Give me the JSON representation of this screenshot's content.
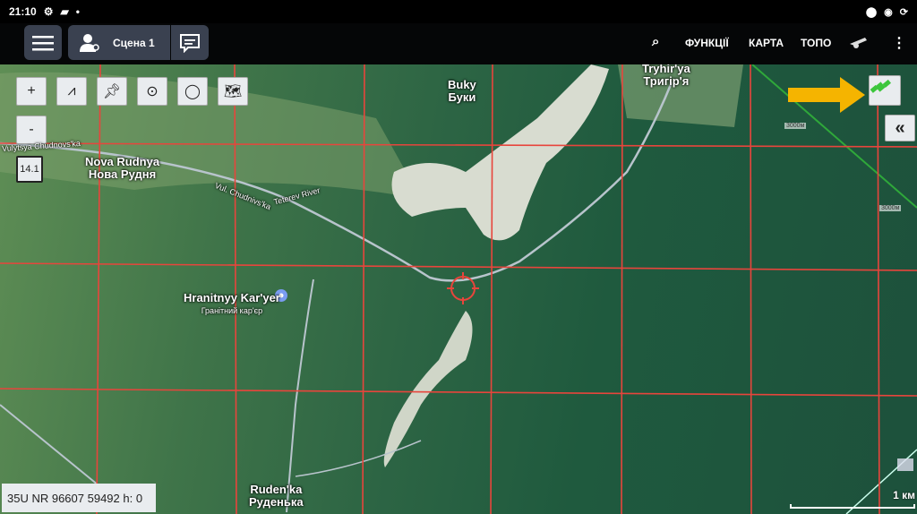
{
  "status": {
    "time": "21:10",
    "icons": [
      "gear-icon",
      "image-icon",
      "dot-icon"
    ],
    "right_icons": [
      "location-icon",
      "eye-icon",
      "sync-icon"
    ]
  },
  "topbar": {
    "scene_label": "Сцена 1",
    "actions": {
      "functions": "ФУНКЦІЇ",
      "map": "КАРТА",
      "topo": "ТОПО"
    }
  },
  "tools": {
    "zoom_in": "+",
    "zoom_out": "-",
    "zoom_level": "14.1",
    "collapse": "«"
  },
  "places": [
    {
      "lat": "Nova Rudnya",
      "cyr": "Нова Рудня"
    },
    {
      "lat": "Buky",
      "cyr": "Буки"
    },
    {
      "lat": "Tryhir'ya",
      "cyr": "Тригір'я"
    },
    {
      "lat": "Hranitnyy Kar'yer",
      "cyr": "Гранітний кар'єр"
    },
    {
      "lat": "Ruden'ka",
      "cyr": "Руденька"
    }
  ],
  "roads": {
    "road1": "Vulytsya Chudnovs'ka",
    "road2": "Vul. Chudnivs'ka",
    "river": "Teterev River"
  },
  "grid_labels": [
    "3000м",
    "3000м"
  ],
  "coords": "35U NR 96607 59492 h: 0",
  "scale": "1 км",
  "colors": {
    "grid": "#e8453c",
    "arrow": "#f5b400",
    "satellite_icon": "#3cc63c",
    "boundary": "#2fa83a"
  }
}
